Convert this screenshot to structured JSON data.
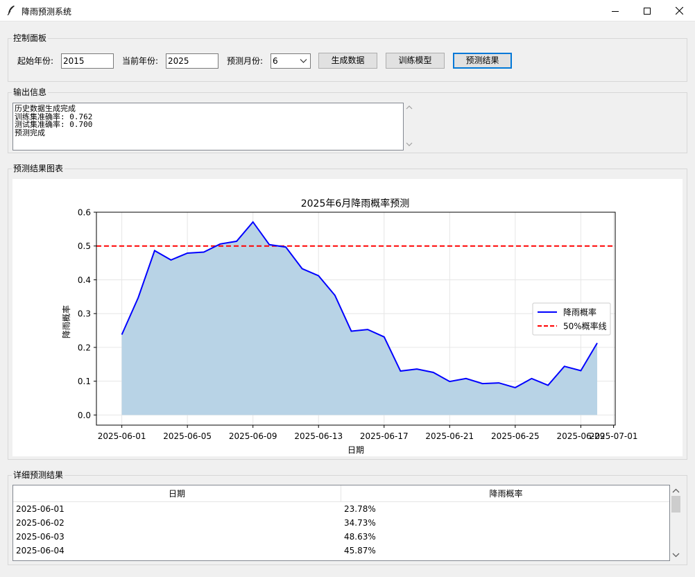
{
  "window": {
    "title": "降雨预测系统"
  },
  "control_panel": {
    "label": "控制面板",
    "start_year_label": "起始年份:",
    "start_year_value": "2015",
    "current_year_label": "当前年份:",
    "current_year_value": "2025",
    "month_label": "预测月份:",
    "month_value": "6",
    "generate_label": "生成数据",
    "train_label": "训练模型",
    "predict_label": "预测结果"
  },
  "output": {
    "label": "输出信息",
    "text": "历史数据生成完成\n训练集准确率: 0.762\n测试集准确率: 0.700\n预测完成"
  },
  "chart_section": {
    "label": "预测结果图表"
  },
  "chart_data": {
    "type": "area",
    "title": "2025年6月降雨概率预测",
    "xlabel": "日期",
    "ylabel": "降雨概率",
    "x": [
      "2025-06-01",
      "2025-06-02",
      "2025-06-03",
      "2025-06-04",
      "2025-06-05",
      "2025-06-06",
      "2025-06-07",
      "2025-06-08",
      "2025-06-09",
      "2025-06-10",
      "2025-06-11",
      "2025-06-12",
      "2025-06-13",
      "2025-06-14",
      "2025-06-15",
      "2025-06-16",
      "2025-06-17",
      "2025-06-18",
      "2025-06-19",
      "2025-06-20",
      "2025-06-21",
      "2025-06-22",
      "2025-06-23",
      "2025-06-24",
      "2025-06-25",
      "2025-06-26",
      "2025-06-27",
      "2025-06-28",
      "2025-06-29",
      "2025-06-30"
    ],
    "series": [
      {
        "name": "降雨概率",
        "color": "#0000ff",
        "fill": "#b8d3e6",
        "values": [
          0.2378,
          0.3473,
          0.4863,
          0.4587,
          0.479,
          0.482,
          0.506,
          0.514,
          0.571,
          0.504,
          0.497,
          0.433,
          0.412,
          0.354,
          0.248,
          0.253,
          0.231,
          0.13,
          0.136,
          0.126,
          0.099,
          0.108,
          0.093,
          0.095,
          0.081,
          0.108,
          0.088,
          0.144,
          0.131,
          0.213
        ]
      }
    ],
    "threshold": {
      "name": "50%概率线",
      "value": 0.5,
      "color": "#ff0000"
    },
    "xtick_labels": [
      "2025-06-01",
      "2025-06-05",
      "2025-06-09",
      "2025-06-13",
      "2025-06-17",
      "2025-06-21",
      "2025-06-25",
      "2025-06-29",
      "2025-07-01"
    ],
    "yticks": [
      "0.0",
      "0.1",
      "0.2",
      "0.3",
      "0.4",
      "0.5",
      "0.6"
    ],
    "ylim": [
      -0.03,
      0.6
    ],
    "grid": true,
    "legend_position": "center-right"
  },
  "details": {
    "label": "详细预测结果",
    "columns": [
      "日期",
      "降雨概率"
    ],
    "rows": [
      [
        "2025-06-01",
        "23.78%"
      ],
      [
        "2025-06-02",
        "34.73%"
      ],
      [
        "2025-06-03",
        "48.63%"
      ],
      [
        "2025-06-04",
        "45.87%"
      ]
    ]
  }
}
